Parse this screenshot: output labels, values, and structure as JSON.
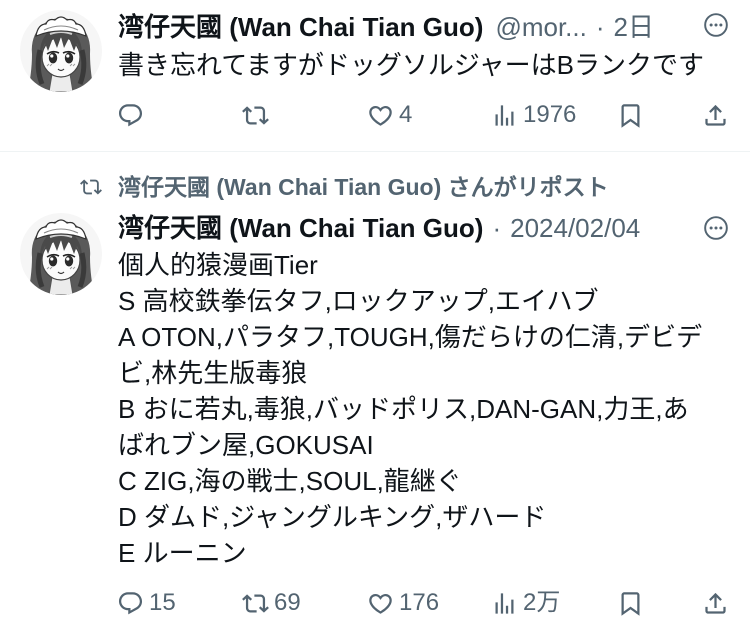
{
  "colors": {
    "background": "#ffffff",
    "text_primary": "#0f1419",
    "text_secondary": "#536471",
    "divider": "#eff3f4"
  },
  "icons": {
    "reply": "reply-icon",
    "repost": "repost-icon",
    "like": "heart-icon",
    "views": "views-bar-chart-icon",
    "bookmark": "bookmark-icon",
    "share": "share-icon",
    "more": "more-options-icon",
    "avatar": "anime-girl-avatar"
  },
  "tweets": [
    {
      "author_name": "湾仔天國 (Wan Chai Tian Guo)",
      "handle": "@mor...",
      "separator": "·",
      "time": "2日",
      "text_lines": [
        "書き忘れてますがドッグソルジャーはBランクです"
      ],
      "counts": {
        "like": "4",
        "views": "1976"
      }
    },
    {
      "repost_label": "湾仔天國 (Wan Chai Tian Guo) さんがリポスト",
      "author_name": "湾仔天國 (Wan Chai Tian Guo)",
      "separator": "·",
      "time": "2024/02/04",
      "text_lines": [
        "個人的猿漫画Tier",
        "S 高校鉄拳伝タフ,ロックアップ,エイハブ",
        "A OTON,パラタフ,TOUGH,傷だらけの仁清,デビデ",
        "ビ,林先生版毒狼",
        "B おに若丸,毒狼,バッドポリス,DAN-GAN,力王,あ",
        "ばれブン屋,GOKUSAI",
        "C ZIG,海の戦士,SOUL,龍継ぐ",
        "D ダムド,ジャングルキング,ザハード",
        "E ルーニン"
      ],
      "counts": {
        "reply": "15",
        "repost": "69",
        "like": "176",
        "views": "2万"
      }
    }
  ]
}
